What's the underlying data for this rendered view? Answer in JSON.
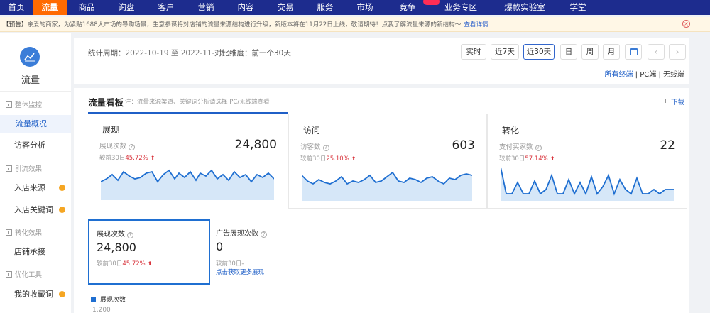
{
  "nav": {
    "items": [
      {
        "label": "首页"
      },
      {
        "label": "流量",
        "active": true
      },
      {
        "label": "商品"
      },
      {
        "label": "询盘"
      },
      {
        "label": "客户"
      },
      {
        "label": "营销"
      },
      {
        "label": "内容"
      },
      {
        "label": "交易"
      },
      {
        "label": "服务"
      },
      {
        "label": "市场"
      },
      {
        "label": "竞争"
      },
      {
        "label": "业务专区"
      },
      {
        "label": "爆款实验室"
      },
      {
        "label": "学堂"
      }
    ]
  },
  "notice": {
    "tag": "【预告】",
    "text": "亲爱的商家，为紧贴1688大市场的导购场景，生意参谋将对店铺的流量来源结构进行升级，新版本将在11月22日上线，敬请期待！点我了解流量来源的新结构～",
    "detail": "查看详情"
  },
  "sidebar": {
    "title": "流量",
    "groups": [
      {
        "label": "整体监控"
      },
      {
        "label": "引流效果"
      },
      {
        "label": "转化效果"
      },
      {
        "label": "优化工具"
      }
    ],
    "items": [
      {
        "label": "流量概况",
        "active": true
      },
      {
        "label": "访客分析"
      },
      {
        "label": "入店来源",
        "dot": true
      },
      {
        "label": "入店关键词",
        "dot": true
      },
      {
        "label": "店铺承接"
      },
      {
        "label": "我的收藏词",
        "dot": true
      }
    ]
  },
  "period": {
    "label": "统计周期：",
    "range": "2022-10-19 至 2022-11-17",
    "compare_label": "对比维度：",
    "compare_value": "前一个30天",
    "buttons": [
      "实时",
      "近7天",
      "近30天",
      "日",
      "周",
      "月"
    ],
    "active_button": "近30天",
    "terminal_all": "所有终端",
    "terminal_pc": "PC端",
    "terminal_wireless": "无线端",
    "sep": "|"
  },
  "board": {
    "title": "流量看板",
    "note": "注：流量来源渠道、关键词分析请选择 PC/无线端查看",
    "download": "下载",
    "metrics": [
      {
        "title": "展现",
        "label": "展现次数",
        "value": "24,800",
        "compare": "较前30日",
        "pct": "45.72%"
      },
      {
        "title": "访问",
        "label": "访客数",
        "value": "603",
        "compare": "较前30日",
        "pct": "25.10%"
      },
      {
        "title": "转化",
        "label": "支付买家数",
        "value": "22",
        "compare": "较前30日",
        "pct": "57.14%"
      }
    ],
    "selected": {
      "label": "展现次数",
      "value": "24,800",
      "compare": "较前30日",
      "pct": "45.72%"
    },
    "ad": {
      "label": "广告展现次数",
      "value": "0",
      "compare": "较前30日-",
      "link": "点击获取更多展现"
    },
    "legend": "展现次数",
    "y_top": "1,200"
  },
  "colors": {
    "nav_bg": "#1d2c8e",
    "nav_active": "#ff6a00",
    "accent": "#1f6fd1",
    "up": "#d9363e"
  }
}
